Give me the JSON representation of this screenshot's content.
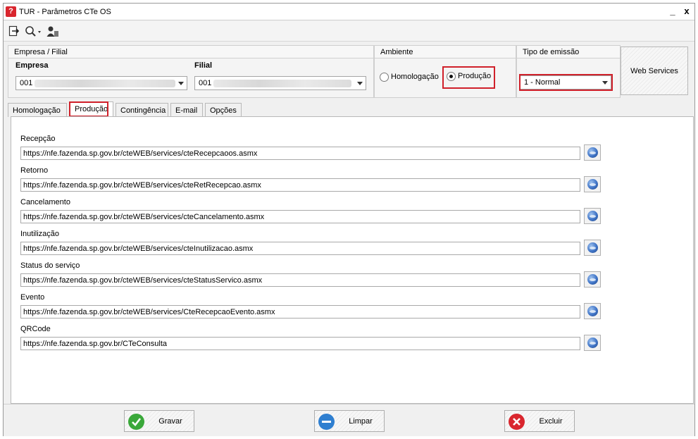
{
  "window": {
    "title": "TUR - Parâmetros CTe OS",
    "app_icon": "app-logo",
    "minimize": "_",
    "close": "x"
  },
  "toolbar": {
    "icons": [
      "exit-icon",
      "search-icon",
      "user-icon"
    ]
  },
  "empresa_filial": {
    "header": "Empresa / Filial",
    "empresa_label": "Empresa",
    "empresa_value": "001",
    "filial_label": "Filial",
    "filial_value": "001"
  },
  "ambiente": {
    "header": "Ambiente",
    "options": [
      "Homologação",
      "Produção"
    ],
    "selected": "Produção"
  },
  "tipo_emissao": {
    "header": "Tipo de emissão",
    "value": "1 - Normal"
  },
  "web_services_button": "Web Services",
  "tabs": [
    "Homologação",
    "Produção",
    "Contingência",
    "E-mail",
    "Opções"
  ],
  "active_tab": "Produção",
  "services": [
    {
      "label": "Recepção",
      "url": "https://nfe.fazenda.sp.gov.br/cteWEB/services/cteRecepcaoos.asmx"
    },
    {
      "label": "Retorno",
      "url": "https://nfe.fazenda.sp.gov.br/cteWEB/services/cteRetRecepcao.asmx"
    },
    {
      "label": "Cancelamento",
      "url": "https://nfe.fazenda.sp.gov.br/cteWEB/services/cteCancelamento.asmx"
    },
    {
      "label": "Inutilização",
      "url": "https://nfe.fazenda.sp.gov.br/cteWEB/services/cteInutilizacao.asmx"
    },
    {
      "label": "Status do serviço",
      "url": "https://nfe.fazenda.sp.gov.br/cteWEB/services/cteStatusServico.asmx"
    },
    {
      "label": "Evento",
      "url": "https://nfe.fazenda.sp.gov.br/cteWEB/services/CteRecepcaoEvento.asmx"
    },
    {
      "label": "QRCode",
      "url": "https://nfe.fazenda.sp.gov.br/CTeConsulta"
    }
  ],
  "footer": {
    "save": "Gravar",
    "clear": "Limpar",
    "delete": "Excluir"
  },
  "colors": {
    "highlight": "#d0202a",
    "save_icon": "#3aa83a",
    "clear_icon": "#2f7fd0",
    "delete_icon": "#d9262e"
  }
}
